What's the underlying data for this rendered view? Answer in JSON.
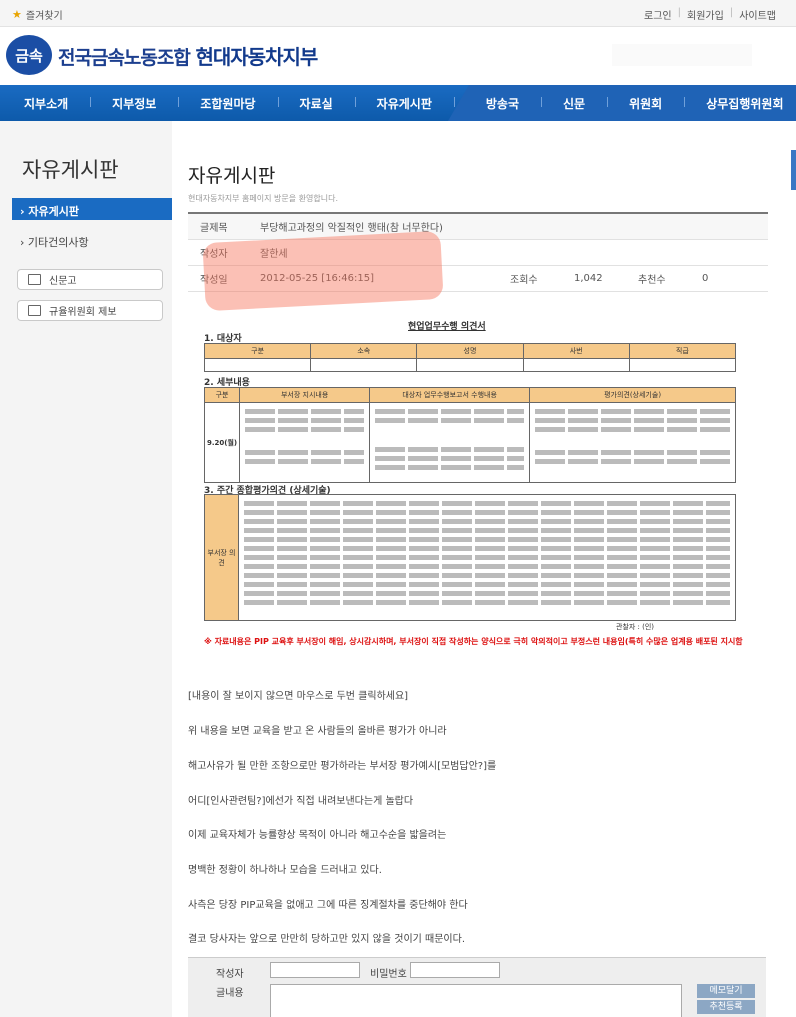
{
  "topbar": {
    "favorites": "즐겨찾기",
    "links": [
      "로그인",
      "회원가입",
      "사이트맵"
    ]
  },
  "header": {
    "logo_mark": "금속",
    "org": "전국금속노동조합",
    "branch": "현대자동차지부"
  },
  "nav": [
    "지부소개",
    "지부정보",
    "조합원마당",
    "자료실",
    "자유게시판",
    "방송국",
    "신문",
    "위원회",
    "상무집행위원회"
  ],
  "sidebar": {
    "title": "자유게시판",
    "active": "자유게시판",
    "item2": "기타건의사항",
    "btn1": "신문고",
    "btn2": "규율위원회 제보"
  },
  "post": {
    "page_title": "자유게시판",
    "page_sub": "현대자동차지부 홈페이지 방문을 환영합니다.",
    "subject_label": "글제목",
    "subject": "부당해고과정의 악질적인 행태(참 너무한다)",
    "author_label": "작성자",
    "author": "잘한세",
    "date_label": "작성일",
    "date": "2012-05-25 [16:46:15]",
    "views_label": "조회수",
    "views": "1,042",
    "recommend_label": "추천수",
    "recommend": "0"
  },
  "doc": {
    "title": "현업업무수행 의견서",
    "sec1": "1. 대상자",
    "sec1_headers": [
      "구분",
      "소속",
      "성명",
      "사번",
      "직급"
    ],
    "sec2": "2. 세부내용",
    "sec2_headers": [
      "구분",
      "부서장 지시내용",
      "대상자 업무수행보고서 수행내용",
      "평가의견(상세기술)"
    ],
    "sec2_date": "9.20(월)",
    "sec3": "3. 주간 종합평가의견 (상세기술)",
    "sec3_label": "부서장 의견",
    "sign": "관찰자 :                    (인)",
    "red_note": "※ 자료내용은 PIP 교육후 부서장이 해임, 상시감시하며, 부서장이 직접 작성하는 양식으로 극히 악의적이고 부정스런 내용임(특히 수많은 업계용 배포된 지시함"
  },
  "body_lines": [
    "[내용이 잘 보이지 않으면 마우스로 두번 클릭하세요]",
    "위 내용을 보면 교육을 받고 온 사람들의 올바른 평가가 아니라",
    "해고사유가 될 만한 조항으로만 평가하라는 부서장 평가예시[모범답안?]를",
    "어디[인사관련팀?]에선가 직접 내려보낸다는게 놀랍다",
    "이제 교육자체가 능률향상 목적이 아니라 해고수순을 밟을려는",
    "명백한 정황이 하나하나 모습을 드러내고 있다.",
    "사측은 당장 PIP교육을 없애고 그에 따른 징계절차를 중단해야 한다",
    "결코 당사자는 앞으로 만만히 당하고만 있지 않을 것이기 때문이다."
  ],
  "form": {
    "author_label": "작성자",
    "password_label": "비밀번호",
    "content_label": "글내용",
    "btn_memo": "메모달기",
    "btn_recommend": "추천등록"
  }
}
